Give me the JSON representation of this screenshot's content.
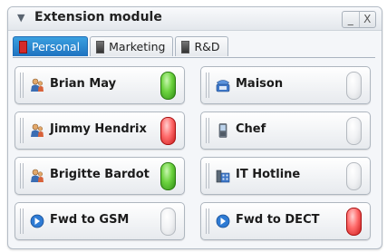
{
  "window": {
    "title": "Extension module",
    "minimize_glyph": "_",
    "close_glyph": "X"
  },
  "tabs": [
    {
      "label": "Personal",
      "active": true
    },
    {
      "label": "Marketing",
      "active": false
    },
    {
      "label": "R&D",
      "active": false
    }
  ],
  "extensions": [
    {
      "label": "Brian May",
      "icon": "user-icon",
      "status": "green"
    },
    {
      "label": "Maison",
      "icon": "phone-icon",
      "status": "off"
    },
    {
      "label": "Jimmy Hendrix",
      "icon": "user-icon",
      "status": "red"
    },
    {
      "label": "Chef",
      "icon": "mobile-phone-icon",
      "status": "off"
    },
    {
      "label": "Brigitte Bardot",
      "icon": "user-icon",
      "status": "green"
    },
    {
      "label": "IT Hotline",
      "icon": "office-building-icon",
      "status": "off"
    },
    {
      "label": "Fwd to GSM",
      "icon": "forward-icon",
      "status": "off"
    },
    {
      "label": "Fwd to DECT",
      "icon": "forward-icon",
      "status": "red"
    }
  ],
  "colors": {
    "active_tab": "#2b86cf",
    "lamp_green": "#6cd33e",
    "lamp_red": "#ff6b6b",
    "lamp_off": "#f1f2f4"
  }
}
